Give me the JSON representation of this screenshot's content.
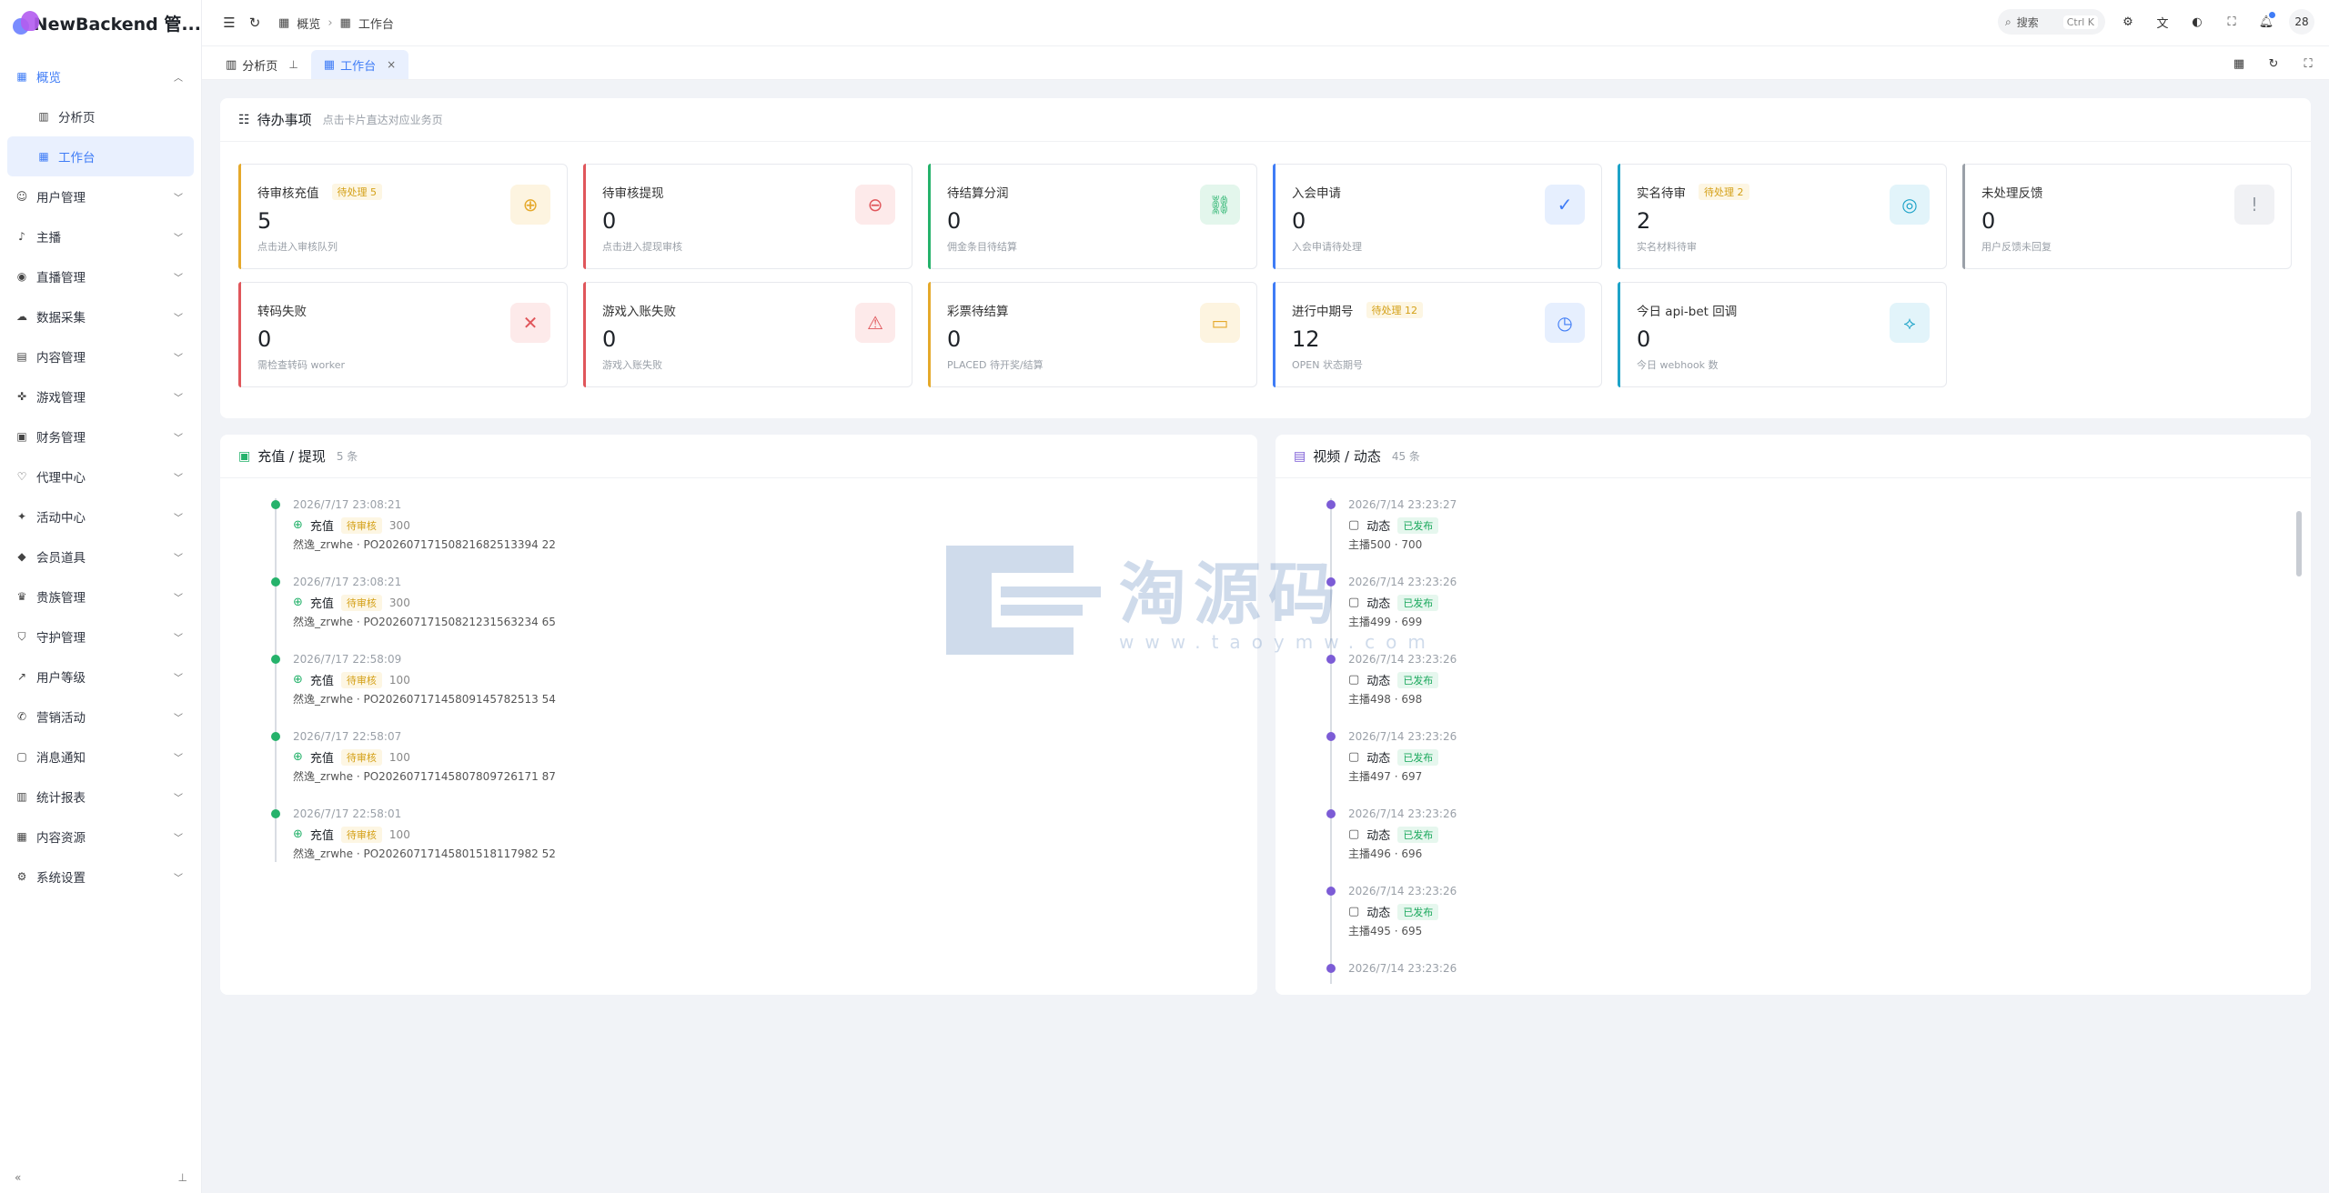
{
  "brand": {
    "name": "NewBackend 管..."
  },
  "sidebar": {
    "items": [
      {
        "label": "概览",
        "icon": "grid-icon",
        "open": true
      },
      {
        "label": "分析页",
        "icon": "chart-icon",
        "sub": true
      },
      {
        "label": "工作台",
        "icon": "grid-icon",
        "sub": true,
        "active": true
      },
      {
        "label": "用户管理",
        "icon": "user-icon"
      },
      {
        "label": "主播",
        "icon": "mic-icon"
      },
      {
        "label": "直播管理",
        "icon": "broadcast-icon"
      },
      {
        "label": "数据采集",
        "icon": "cloud-icon"
      },
      {
        "label": "内容管理",
        "icon": "folder-icon"
      },
      {
        "label": "游戏管理",
        "icon": "gamepad-icon"
      },
      {
        "label": "财务管理",
        "icon": "wallet-icon"
      },
      {
        "label": "代理中心",
        "icon": "handshake-icon"
      },
      {
        "label": "活动中心",
        "icon": "activity-icon"
      },
      {
        "label": "会员道具",
        "icon": "gem-icon"
      },
      {
        "label": "贵族管理",
        "icon": "crown-icon"
      },
      {
        "label": "守护管理",
        "icon": "shield-icon"
      },
      {
        "label": "用户等级",
        "icon": "trend-icon"
      },
      {
        "label": "营销活动",
        "icon": "megaphone-icon"
      },
      {
        "label": "消息通知",
        "icon": "message-icon"
      },
      {
        "label": "统计报表",
        "icon": "bar-chart-icon"
      },
      {
        "label": "内容资源",
        "icon": "library-icon"
      },
      {
        "label": "系统设置",
        "icon": "gear-icon"
      }
    ],
    "collapse_label": "«",
    "pin_label": "⊥"
  },
  "header": {
    "breadcrumbs": [
      "概览",
      "工作台"
    ],
    "search_label": "搜索",
    "search_kbd": "Ctrl K",
    "avatar_label": "28"
  },
  "tabs": [
    {
      "label": "分析页",
      "icon": "chart-icon",
      "pinned": true
    },
    {
      "label": "工作台",
      "icon": "grid-icon",
      "active": true
    }
  ],
  "todo": {
    "title": "待办事项",
    "subtitle": "点击卡片直达对应业务页",
    "cards": [
      {
        "title": "待审核充值",
        "badge": "待处理 5",
        "value": "5",
        "desc": "点击进入审核队列",
        "color": "#e5a92b",
        "icon": "plus-circle-icon",
        "glyph": "⊕",
        "bg": "#fdf4e0"
      },
      {
        "title": "待审核提现",
        "badge": "",
        "value": "0",
        "desc": "点击进入提现审核",
        "color": "#e0565b",
        "icon": "minus-circle-icon",
        "glyph": "⊖",
        "bg": "#fdeaea"
      },
      {
        "title": "待结算分润",
        "badge": "",
        "value": "0",
        "desc": "佣金条目待结算",
        "color": "#25b26b",
        "icon": "link-icon",
        "glyph": "⛓",
        "bg": "#e3f6ec"
      },
      {
        "title": "入会申请",
        "badge": "",
        "value": "0",
        "desc": "入会申请待处理",
        "color": "#3f7cf6",
        "icon": "shield-check-icon",
        "glyph": "✓",
        "bg": "#e6effe"
      },
      {
        "title": "实名待审",
        "badge": "待处理 2",
        "value": "2",
        "desc": "实名材料待审",
        "color": "#1ea3c8",
        "icon": "fingerprint-icon",
        "glyph": "◎",
        "bg": "#e2f4fa"
      },
      {
        "title": "未处理反馈",
        "badge": "",
        "value": "0",
        "desc": "用户反馈未回复",
        "color": "#9aa0a8",
        "icon": "feedback-icon",
        "glyph": "!",
        "bg": "#f0f1f4"
      },
      {
        "title": "转码失败",
        "badge": "",
        "value": "0",
        "desc": "需检查转码 worker",
        "color": "#e0565b",
        "icon": "file-x-icon",
        "glyph": "✕",
        "bg": "#fdeaea"
      },
      {
        "title": "游戏入账失败",
        "badge": "",
        "value": "0",
        "desc": "游戏入账失败",
        "color": "#e0565b",
        "icon": "warning-icon",
        "glyph": "⚠",
        "bg": "#fdeaea"
      },
      {
        "title": "彩票待结算",
        "badge": "",
        "value": "0",
        "desc": "PLACED 待开奖/结算",
        "color": "#e5a92b",
        "icon": "ticket-icon",
        "glyph": "▭",
        "bg": "#fdf4e0"
      },
      {
        "title": "进行中期号",
        "badge": "待处理 12",
        "value": "12",
        "desc": "OPEN 状态期号",
        "color": "#3f7cf6",
        "icon": "calendar-clock-icon",
        "glyph": "◷",
        "bg": "#e6effe"
      },
      {
        "title": "今日 api-bet 回调",
        "badge": "",
        "value": "0",
        "desc": "今日 webhook 数",
        "color": "#1ea3c8",
        "icon": "webhook-icon",
        "glyph": "⟡",
        "bg": "#e2f4fa"
      }
    ]
  },
  "recharge": {
    "title": "充值 / 提现",
    "count": "5 条",
    "items": [
      {
        "time": "2026/7/17 23:08:21",
        "type": "充值",
        "status": "待审核",
        "amount": "300",
        "detail": "然逸_zrwhe · PO20260717150821682513394 22"
      },
      {
        "time": "2026/7/17 23:08:21",
        "type": "充值",
        "status": "待审核",
        "amount": "300",
        "detail": "然逸_zrwhe · PO20260717150821231563234 65"
      },
      {
        "time": "2026/7/17 22:58:09",
        "type": "充值",
        "status": "待审核",
        "amount": "100",
        "detail": "然逸_zrwhe · PO20260717145809145782513 54"
      },
      {
        "time": "2026/7/17 22:58:07",
        "type": "充值",
        "status": "待审核",
        "amount": "100",
        "detail": "然逸_zrwhe · PO20260717145807809726171 87"
      },
      {
        "time": "2026/7/17 22:58:01",
        "type": "充值",
        "status": "待审核",
        "amount": "100",
        "detail": "然逸_zrwhe · PO20260717145801518117982 52"
      }
    ]
  },
  "video": {
    "title": "视频 / 动态",
    "count": "45 条",
    "items": [
      {
        "time": "2026/7/14 23:23:27",
        "type": "动态",
        "status": "已发布",
        "detail": "主播500 · 700"
      },
      {
        "time": "2026/7/14 23:23:26",
        "type": "动态",
        "status": "已发布",
        "detail": "主播499 · 699"
      },
      {
        "time": "2026/7/14 23:23:26",
        "type": "动态",
        "status": "已发布",
        "detail": "主播498 · 698"
      },
      {
        "time": "2026/7/14 23:23:26",
        "type": "动态",
        "status": "已发布",
        "detail": "主播497 · 697"
      },
      {
        "time": "2026/7/14 23:23:26",
        "type": "动态",
        "status": "已发布",
        "detail": "主播496 · 696"
      },
      {
        "time": "2026/7/14 23:23:26",
        "type": "动态",
        "status": "已发布",
        "detail": "主播495 · 695"
      },
      {
        "time": "2026/7/14 23:23:26",
        "type": "",
        "status": "",
        "detail": ""
      }
    ]
  },
  "watermark": {
    "text": "淘源码",
    "url": "www.taoymw.com"
  }
}
